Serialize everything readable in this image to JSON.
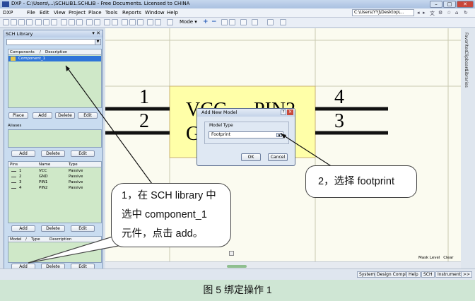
{
  "window": {
    "title": "DXP - C:\\Users\\...\\SCHLIB1.SCHLIB - Free Documents. Licensed to CHINA",
    "buttons": [
      "–",
      "□",
      "✕"
    ]
  },
  "menu": {
    "items": [
      "DXP",
      "File",
      "Edit",
      "View",
      "Project",
      "Place",
      "Tools",
      "Reports",
      "Window",
      "Help"
    ],
    "path": "C:\\Users\\YYJ\\Desktop\\..."
  },
  "toolbar": {
    "mode_label": "Mode ▾"
  },
  "sch_library": {
    "title": "SCH Library",
    "components": {
      "headers": [
        "Components",
        "/",
        "Description"
      ],
      "rows": [
        {
          "name": "Component_1",
          "description": ""
        }
      ],
      "buttons": [
        "Place",
        "Add",
        "Delete",
        "Edit"
      ]
    },
    "aliases": {
      "title": "Aliases",
      "buttons": [
        "Add",
        "Delete",
        "Edit"
      ]
    },
    "pins": {
      "headers": [
        "Pins",
        "Name",
        "Type"
      ],
      "rows": [
        {
          "pin": "1",
          "name": "VCC",
          "type": "Passive"
        },
        {
          "pin": "2",
          "name": "GND",
          "type": "Passive"
        },
        {
          "pin": "3",
          "name": "PIN1",
          "type": "Passive"
        },
        {
          "pin": "4",
          "name": "PIN2",
          "type": "Passive"
        }
      ],
      "buttons": [
        "Add",
        "Delete",
        "Edit"
      ]
    },
    "models": {
      "headers": [
        "Model",
        "/",
        "Type",
        "Description"
      ],
      "buttons": [
        "Add",
        "Delete",
        "Edit"
      ]
    }
  },
  "schematic": {
    "pin_numbers": [
      "1",
      "2",
      "4",
      "3"
    ],
    "labels": [
      "VCC",
      "PIN2",
      "G"
    ]
  },
  "dialog": {
    "title": "Add New Model",
    "group_label": "Model Type",
    "selected": "Footprint",
    "ok": "OK",
    "cancel": "Cancel"
  },
  "right_tabs": [
    "Favorites",
    "Clipboard",
    "Libraries"
  ],
  "status_bar": {
    "mask_level": "Mask Level",
    "clear": "Clear",
    "tabs": [
      "System",
      "Design Compiler",
      "Help",
      "SCH",
      "Instruments",
      ">>"
    ]
  },
  "callouts": {
    "step1_lines": [
      "1，在 SCH library 中",
      "选中  component_1",
      "元件，点击 add。"
    ],
    "step2": "2，选择 footprint"
  },
  "caption": "图 5  绑定操作 1",
  "colors": {
    "selection": "#2e74d8",
    "body_fill": "#ffffa8",
    "panel_green": "#cfe8c8"
  }
}
